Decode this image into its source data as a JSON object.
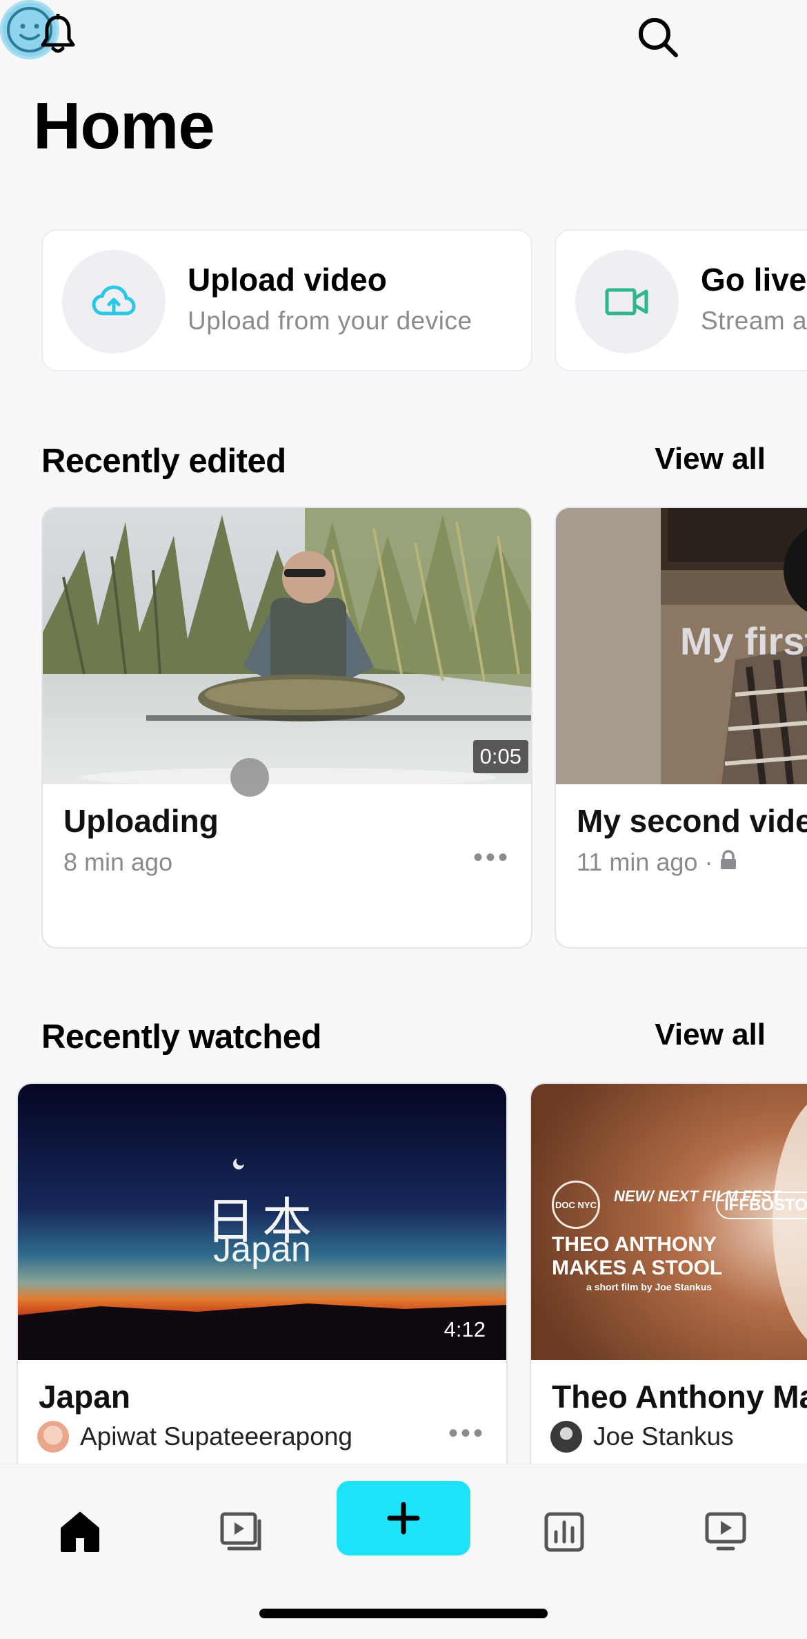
{
  "header": {
    "title": "Home",
    "icons": [
      "bell-icon",
      "search-icon",
      "avatar"
    ]
  },
  "actions": [
    {
      "title": "Upload video",
      "subtitle": "Upload from your device",
      "icon": "cloud-upload-icon"
    },
    {
      "title": "Go live",
      "subtitle": "Stream a",
      "icon": "video-camera-icon"
    }
  ],
  "recently_edited": {
    "title": "Recently edited",
    "view_all": "View all",
    "items": [
      {
        "title": "Uploading",
        "meta": "8 min ago",
        "duration": "0:05"
      },
      {
        "title": "My second vide",
        "meta": "11 min ago ·",
        "overlay_text": "My first"
      }
    ]
  },
  "recently_watched": {
    "title": "Recently watched",
    "view_all": "View all",
    "items": [
      {
        "title": "Japan",
        "author": "Apiwat Supateeerapong",
        "duration": "4:12",
        "thumb_kanji": "日本",
        "thumb_text": "Japan"
      },
      {
        "title": "Theo Anthony Ma",
        "author": "Joe Stankus",
        "thumb_line1": "THEO ANTHONY",
        "thumb_line2": "MAKES A STOOL",
        "thumb_small": "a short film by Joe Stankus",
        "badge1": "DOC NYC",
        "badge2": "NEW/ NEXT",
        "badge2b": "FILM FEST",
        "badge3": "IFFBOSTON"
      }
    ]
  },
  "bottom_nav": {
    "items": [
      "home-icon",
      "library-icon",
      "create-button",
      "analytics-icon",
      "watch-icon"
    ]
  },
  "colors": {
    "accent": "#1ee2f8",
    "upload_icon": "#29c9e6",
    "live_icon": "#2fb58f"
  }
}
